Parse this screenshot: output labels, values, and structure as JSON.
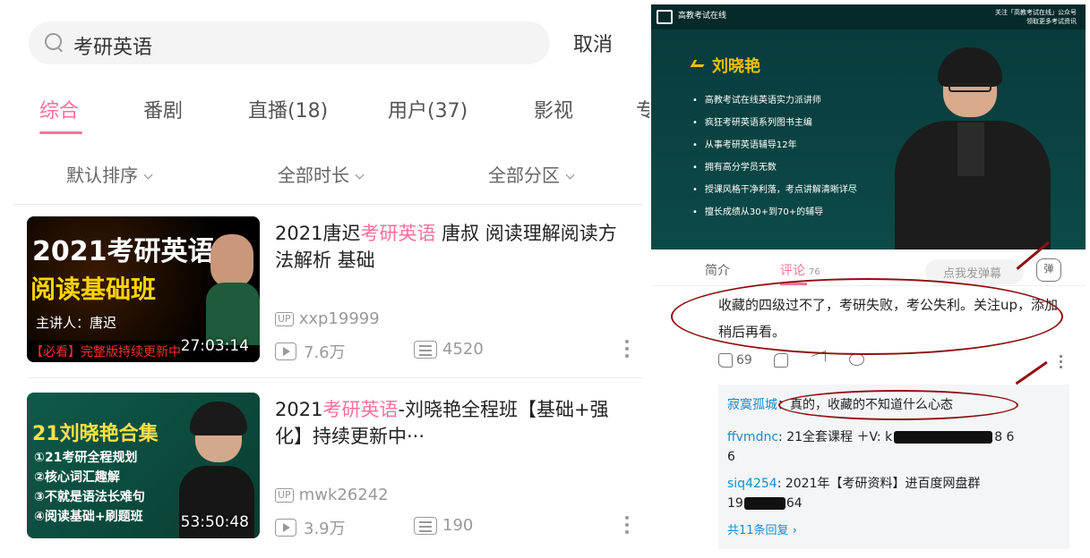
{
  "left": {
    "search": {
      "query": "考研英语",
      "cancel": "取消"
    },
    "tabs": [
      "综合",
      "番剧",
      "直播(18)",
      "用户(37)",
      "影视"
    ],
    "tab_overflow": "专",
    "filters": [
      "默认排序",
      "全部时长",
      "全部分区"
    ],
    "videos": [
      {
        "title_pre": "2021唐迟",
        "title_hl": "考研英语",
        "title_post": " 唐叔 阅读理解阅读方法解析 基础",
        "thumb_line1": "2021考研英语",
        "thumb_line2": "阅读基础班",
        "thumb_line3": "主讲人：唐迟",
        "thumb_banner": "【必看】完整版持续更新中",
        "duration": "27:03:14",
        "up_badge": "UP",
        "uploader": "xxp19999",
        "views": "7.6万",
        "danmaku": "4520"
      },
      {
        "title_pre": "2021",
        "title_hl": "考研英语",
        "title_post": "-刘晓艳全程班【基础+强化】持续更新中···",
        "thumb_line1": "21刘晓艳合集",
        "thumb_items": [
          "①21考研全程规划",
          "②核心词汇趣解",
          "③不就是语法长难句",
          "④阅读基础+刷题班"
        ],
        "duration": "53:50:48",
        "up_badge": "UP",
        "uploader": "mwk26242",
        "views": "3.9万",
        "danmaku": "190"
      }
    ]
  },
  "right": {
    "player": {
      "logo_text": "高教考试在线",
      "promo": [
        "关注「高教考试在线」公众号",
        "领取更多考试资讯"
      ],
      "lecturer_name": "刘晓艳",
      "bullets": [
        "高教考试在线英语实力派讲师",
        "疯狂考研英语系列图书主编",
        "从事考研英语辅导12年",
        "拥有高分学员无数",
        "授课风格干净利落，考点讲解清晰详尽",
        "擅长成绩从30+到70+的辅导"
      ]
    },
    "tabs": {
      "intro": "简介",
      "comments": "评论",
      "comment_count": "76"
    },
    "danmaku_placeholder": "点我发弹幕",
    "danmaku_toggle": "弹",
    "comment": {
      "text": "收藏的四级过不了，考研失败，考公失利。关注up，添加稍后再看。",
      "likes": "69"
    },
    "replies": [
      {
        "user": "寂寞孤城",
        "text": "：真的，收藏的不知道什么心态"
      },
      {
        "user": "ffvmdnc",
        "text": ": 21全套课程 ＋V:  k",
        "tail": "8  6",
        "line2": "6"
      },
      {
        "user": "siq4254",
        "text": ": 2021年【考研资料】进百度网盘群",
        "line2_pre": "19",
        "line2_post": "64"
      }
    ],
    "more_replies": "共11条回复 ›"
  },
  "colors": {
    "accent": "#fb7299",
    "link": "#178bcf",
    "annotation": "#8f0f0f"
  }
}
